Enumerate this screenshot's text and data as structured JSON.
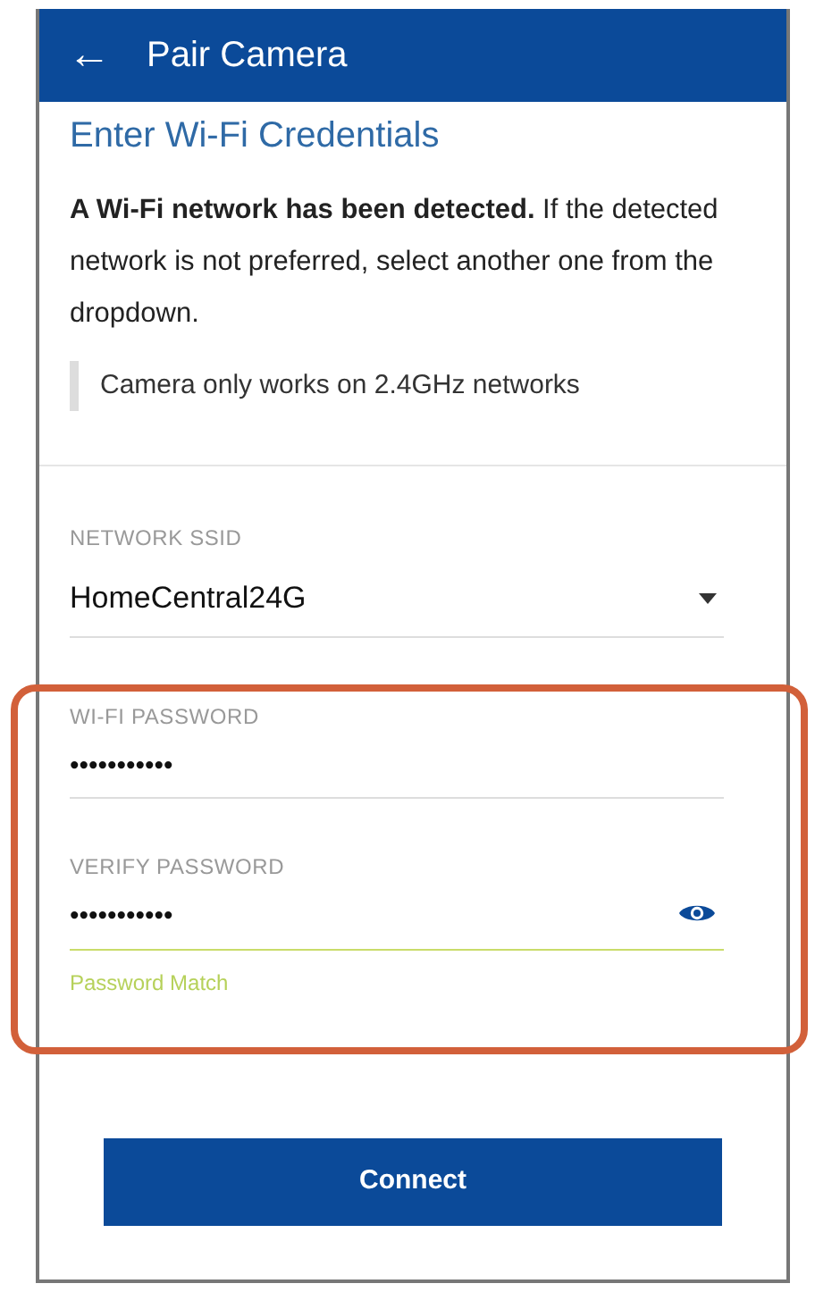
{
  "header": {
    "back_icon": "←",
    "title": "Pair Camera"
  },
  "heading": "Enter Wi-Fi Credentials",
  "intro": "**A Wi-Fi network has been detected.** If the detected network is not preferred, select another one from the dropdown.",
  "note": "Camera only works on 2.4GHz networks",
  "ssid_field": {
    "label": "NETWORK SSID",
    "value": "HomeCentral24G"
  },
  "password_section": {
    "highlighted": true,
    "fields": [
      {
        "label": "WI-FI PASSWORD",
        "value": "•••••••••••",
        "focused": false,
        "show_toggle": false
      },
      {
        "label": "VERIFY PASSWORD",
        "value": "•••••••••••",
        "focused": true,
        "show_toggle": true
      }
    ],
    "helper": {
      "text": "Password Match",
      "matched": true
    }
  },
  "connect_button": "Connect"
}
